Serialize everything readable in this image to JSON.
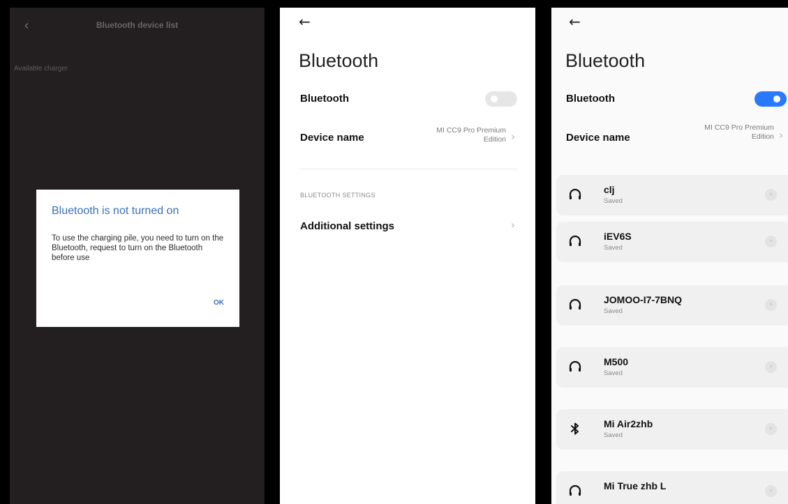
{
  "screen1": {
    "back_icon": "chevron-left-icon",
    "title": "Bluetooth device list",
    "section_label": "Available charger",
    "dialog": {
      "title": "Bluetooth is not turned on",
      "body": "To use the charging pile, you need to turn on the Bluetooth, request to turn on the Bluetooth before use",
      "ok_label": "OK"
    }
  },
  "screen2": {
    "back_icon": "arrow-left-icon",
    "title": "Bluetooth",
    "bluetooth_label": "Bluetooth",
    "bluetooth_on": false,
    "device_name_label": "Device name",
    "device_name_value_line1": "MI CC9 Pro Premium",
    "device_name_value_line2": "Edition",
    "settings_header": "BLUETOOTH SETTINGS",
    "additional_settings_label": "Additional settings"
  },
  "screen3": {
    "back_icon": "arrow-left-icon",
    "title": "Bluetooth",
    "bluetooth_label": "Bluetooth",
    "bluetooth_on": true,
    "device_name_label": "Device name",
    "device_name_value_line1": "MI CC9 Pro Premium",
    "device_name_value_line2": "Edition",
    "devices": [
      {
        "name": "clj",
        "status": "Saved",
        "icon": "headphones-icon"
      },
      {
        "name": "iEV6S",
        "status": "Saved",
        "icon": "headphones-icon"
      },
      {
        "name": "JOMOO-I7-7BNQ",
        "status": "Saved",
        "icon": "headphones-icon"
      },
      {
        "name": "M500",
        "status": "Saved",
        "icon": "headphones-icon"
      },
      {
        "name": "Mi Air2zhb",
        "status": "Saved",
        "icon": "bluetooth-icon"
      },
      {
        "name": "Mi True zhb L",
        "status": "",
        "icon": "headphones-icon"
      }
    ]
  },
  "colors": {
    "dark_bg": "#231f20",
    "accent_blue": "#3b6fb6",
    "toggle_on": "#2979ff",
    "toggle_off": "#e6e6e6"
  }
}
